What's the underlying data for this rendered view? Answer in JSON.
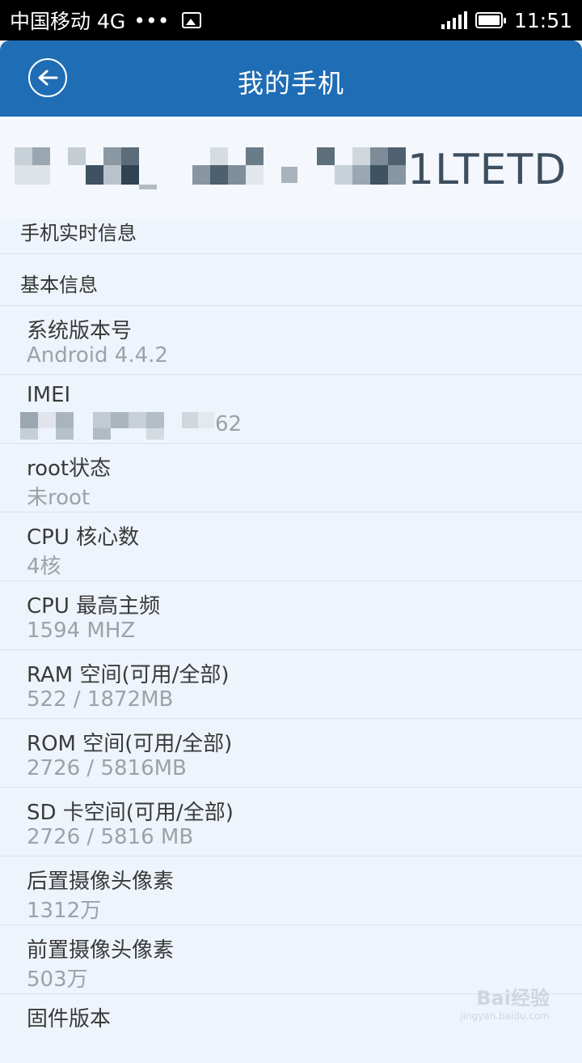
{
  "status_bar": {
    "carrier": "中国移动 4G",
    "dots": "•••",
    "time": "11:51"
  },
  "app_bar": {
    "title": "我的手机"
  },
  "device": {
    "name_visible_suffix": "1LTETD"
  },
  "sections": {
    "realtime": "手机实时信息",
    "basic": "基本信息"
  },
  "items": [
    {
      "label": "系统版本号",
      "value": "Android 4.4.2"
    },
    {
      "label": "IMEI",
      "value": "62"
    },
    {
      "label": "root状态",
      "value": "未root"
    },
    {
      "label": "CPU 核心数",
      "value": "4核"
    },
    {
      "label": "CPU 最高主频",
      "value": "1594 MHZ"
    },
    {
      "label": "RAM 空间(可用/全部)",
      "value": "522 / 1872MB"
    },
    {
      "label": "ROM 空间(可用/全部)",
      "value": "2726 / 5816MB"
    },
    {
      "label": "SD 卡空间(可用/全部)",
      "value": "2726 / 5816 MB"
    },
    {
      "label": "后置摄像头像素",
      "value": "1312万"
    },
    {
      "label": "前置摄像头像素",
      "value": "503万"
    },
    {
      "label": "固件版本",
      "value": ""
    }
  ],
  "watermark": {
    "brand": "Bai经验",
    "url": "jingyan.baidu.com"
  },
  "colors": {
    "app_bar": "#1f6db4",
    "background": "#eef4fb",
    "label": "#3a3a3a",
    "value": "#9aa3a8"
  }
}
